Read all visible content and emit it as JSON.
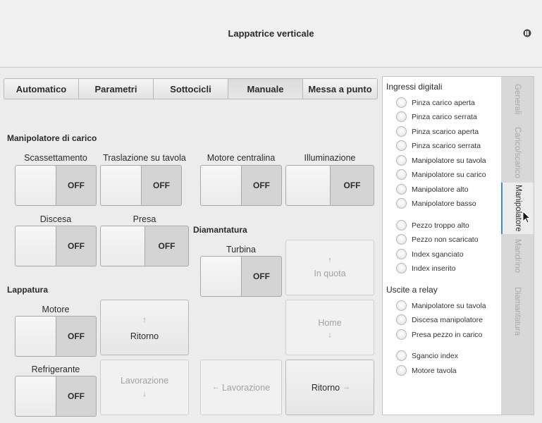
{
  "window": {
    "title": "Lappatrice verticale",
    "icon": "app-menu-icon"
  },
  "tabs": [
    {
      "label": "Automatico",
      "active": false
    },
    {
      "label": "Parametri",
      "active": false
    },
    {
      "label": "Sottocicli",
      "active": false
    },
    {
      "label": "Manuale",
      "active": true
    },
    {
      "label": "Messa a punto",
      "active": false
    }
  ],
  "sections": {
    "manipolatore": "Manipolatore di carico",
    "diamantatura": "Diamantatura",
    "lappatura": "Lappatura"
  },
  "toggles": {
    "scassettamento": {
      "label": "Scassettamento",
      "state": "OFF"
    },
    "traslazione": {
      "label": "Traslazione su tavola",
      "state": "OFF"
    },
    "motore_centralina": {
      "label": "Motore centralina",
      "state": "OFF"
    },
    "illuminazione": {
      "label": "Illuminazione",
      "state": "OFF"
    },
    "discesa": {
      "label": "Discesa",
      "state": "OFF"
    },
    "presa": {
      "label": "Presa",
      "state": "OFF"
    },
    "turbina": {
      "label": "Turbina",
      "state": "OFF"
    },
    "motore": {
      "label": "Motore",
      "state": "OFF"
    },
    "refrigerante": {
      "label": "Refrigerante",
      "state": "OFF"
    }
  },
  "buttons": {
    "in_quota": {
      "label": "In quota",
      "arrow": "↑",
      "enabled": false
    },
    "ritorno_lapp": {
      "label": "Ritorno",
      "arrow": "↑",
      "enabled": true
    },
    "home": {
      "label": "Home",
      "arrow": "↓",
      "enabled": false
    },
    "lavorazione_lapp": {
      "label": "Lavorazione",
      "arrow": "↓",
      "enabled": false
    },
    "lavorazione_diam": {
      "label": "Lavorazione",
      "arrow": "←",
      "enabled": false
    },
    "ritorno_diam": {
      "label": "Ritorno",
      "arrow": "→",
      "enabled": true
    }
  },
  "ingressi": {
    "title": "Ingressi digitali",
    "items": [
      "Pinza carico aperta",
      "Pinza carico serrata",
      "Pinza scarico aperta",
      "Pinza scarico serrata",
      "Manipolatore su tavola",
      "Manipolatore su carico",
      "Manipolatore alto",
      "Manipolatore basso",
      "Pezzo troppo alto",
      "Pezzo non scaricato",
      "Index sganciato",
      "Index inserito"
    ]
  },
  "uscite": {
    "title": "Uscite a relay",
    "items": [
      "Manipolatore su tavola",
      "Discesa manipolatore",
      "Presa pezzo in carico",
      "Sgancio index",
      "Motore tavola"
    ]
  },
  "side_tabs": [
    {
      "label": "Generali",
      "active": false
    },
    {
      "label": "Carico/scarico",
      "active": false
    },
    {
      "label": "Manipolatore",
      "active": true
    },
    {
      "label": "Mandrino",
      "active": false
    },
    {
      "label": "Diamantatura",
      "active": false
    }
  ]
}
